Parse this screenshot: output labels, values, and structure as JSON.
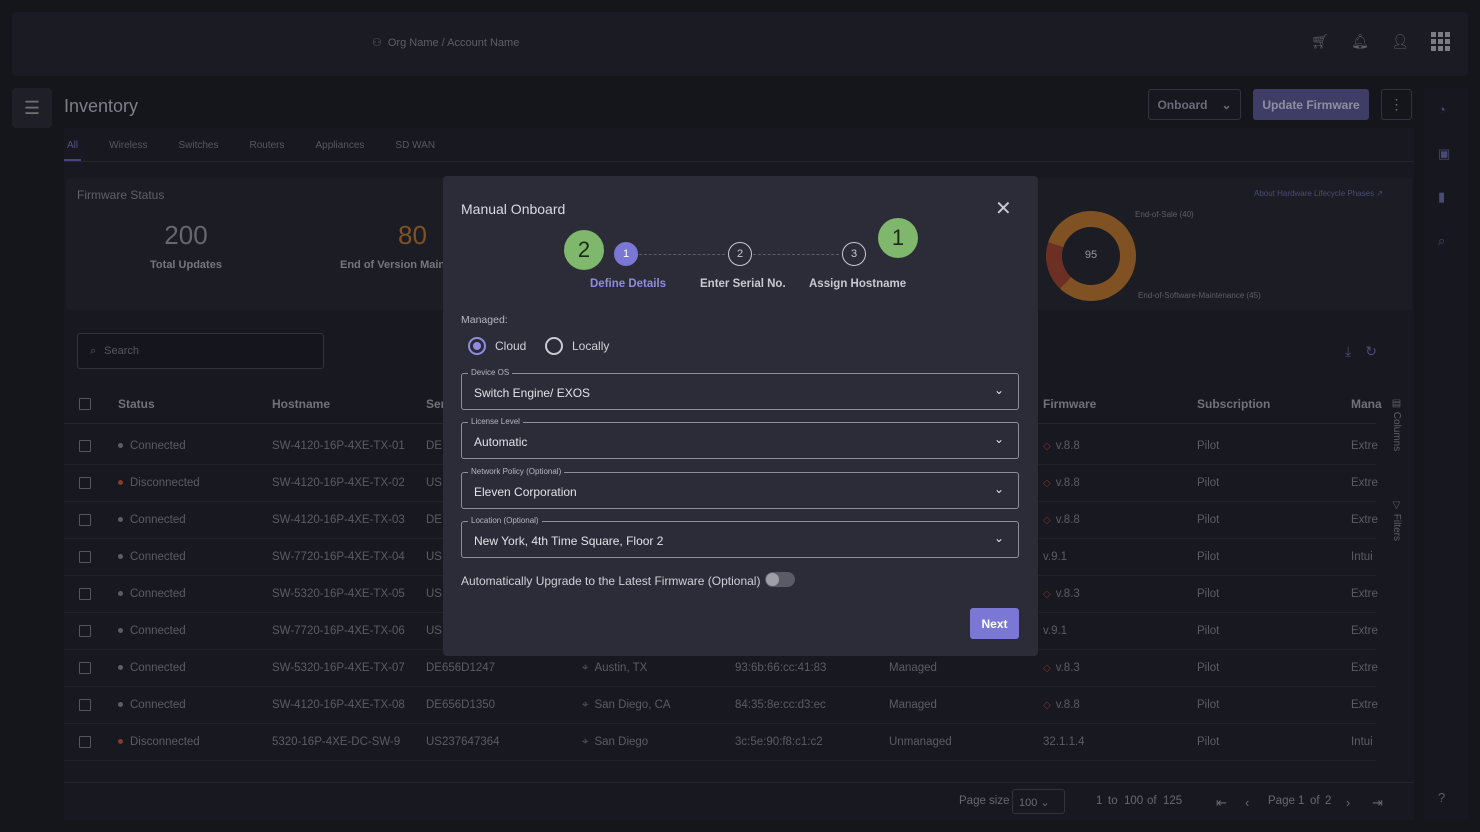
{
  "header": {
    "org_path": "Org Name / Account Name"
  },
  "page": {
    "title": "Inventory",
    "onboard_label": "Onboard",
    "update_firmware_label": "Update Firmware"
  },
  "tabs": [
    "All",
    "Wireless",
    "Switches",
    "Routers",
    "Appliances",
    "SD WAN"
  ],
  "firmware_status": {
    "title": "Firmware Status",
    "total_value": "200",
    "total_label": "Total Updates",
    "eovm_value": "80",
    "eovm_label": "End of Version Main",
    "donut_value": "95",
    "end_of_sale": "End-of-Sale (40)",
    "end_of_sw_maint": "End-of-Software-Maintenance (45)",
    "about_link": "About Hardware Lifecycle Phases"
  },
  "search": {
    "placeholder": "Search"
  },
  "table": {
    "headers": {
      "status": "Status",
      "hostname": "Hostname",
      "serial": "Ser",
      "firmware": "Firmware",
      "subscription": "Subscription",
      "managed_by": "Mana"
    },
    "rows": [
      {
        "status": "Connected",
        "hostname": "SW-4120-16P-4XE-TX-01",
        "serial": "DE",
        "location": "",
        "mac": "",
        "managed": "",
        "firmware": "v.8.8",
        "fw_warn": true,
        "subscription": "Pilot",
        "mgr": "Extre"
      },
      {
        "status": "Disconnected",
        "hostname": "SW-4120-16P-4XE-TX-02",
        "serial": "US",
        "location": "",
        "mac": "",
        "managed": "",
        "firmware": "v.8.8",
        "fw_warn": true,
        "subscription": "Pilot",
        "mgr": "Extre"
      },
      {
        "status": "Connected",
        "hostname": "SW-4120-16P-4XE-TX-03",
        "serial": "DE",
        "location": "",
        "mac": "",
        "managed": "",
        "firmware": "v.8.8",
        "fw_warn": true,
        "subscription": "Pilot",
        "mgr": "Extre"
      },
      {
        "status": "Connected",
        "hostname": "SW-7720-16P-4XE-TX-04",
        "serial": "US",
        "location": "",
        "mac": "",
        "managed": "",
        "firmware": "v.9.1",
        "fw_warn": false,
        "subscription": "Pilot",
        "mgr": "Intui"
      },
      {
        "status": "Connected",
        "hostname": "SW-5320-16P-4XE-TX-05",
        "serial": "US",
        "location": "",
        "mac": "",
        "managed": "",
        "firmware": "v.8.3",
        "fw_warn": true,
        "subscription": "Pilot",
        "mgr": "Extre"
      },
      {
        "status": "Connected",
        "hostname": "SW-7720-16P-4XE-TX-06",
        "serial": "US",
        "location": "",
        "mac": "",
        "managed": "",
        "firmware": "v.9.1",
        "fw_warn": false,
        "subscription": "Pilot",
        "mgr": "Extre"
      },
      {
        "status": "Connected",
        "hostname": "SW-5320-16P-4XE-TX-07",
        "serial": "DE656D1247",
        "location": "Austin, TX",
        "mac": "93:6b:66:cc:41:83",
        "managed": "Managed",
        "firmware": "v.8.3",
        "fw_warn": true,
        "subscription": "Pilot",
        "mgr": "Extre"
      },
      {
        "status": "Connected",
        "hostname": "SW-4120-16P-4XE-TX-08",
        "serial": "DE656D1350",
        "location": "San Diego, CA",
        "mac": "84:35:8e:cc:d3:ec",
        "managed": "Managed",
        "firmware": "v.8.8",
        "fw_warn": true,
        "subscription": "Pilot",
        "mgr": "Extre"
      },
      {
        "status": "Disconnected",
        "hostname": "5320-16P-4XE-DC-SW-9",
        "serial": "US237647364",
        "location": "San Diego",
        "mac": "3c:5e:90:f8:c1:c2",
        "managed": "Unmanaged",
        "firmware": "32.1.1.4",
        "fw_warn": false,
        "subscription": "Pilot",
        "mgr": "Intui"
      }
    ]
  },
  "side_tabs": {
    "columns": "Columns",
    "filters": "Filters"
  },
  "pager": {
    "page_size_label": "Page size",
    "page_size": "100",
    "range_from": "1",
    "to_word": "to",
    "range_to": "100",
    "of_word": "of",
    "total": "125",
    "page_word": "Page",
    "page": "1",
    "pages": "2"
  },
  "modal": {
    "title": "Manual Onboard",
    "steps": [
      {
        "num": "1",
        "label": "Define Details"
      },
      {
        "num": "2",
        "label": "Enter Serial No."
      },
      {
        "num": "3",
        "label": "Assign Hostname"
      }
    ],
    "annotation_badges": [
      "2",
      "1"
    ],
    "managed_label": "Managed:",
    "radio_cloud": "Cloud",
    "radio_locally": "Locally",
    "device_os_label": "Device OS",
    "device_os_value": "Switch Engine/ EXOS",
    "license_label": "License Level",
    "license_value": "Automatic",
    "policy_label": "Network Policy (Optional)",
    "policy_value": "Eleven Corporation",
    "location_label": "Location (Optional)",
    "location_value": "New York, 4th Time Square, Floor 2",
    "auto_upgrade_label": "Automatically Upgrade to the Latest Firmware (Optional)",
    "next_label": "Next"
  },
  "colors": {
    "accent": "#7b77d4",
    "badge_green": "#7fb76d",
    "status_connected": "#8a8b96",
    "status_disconnected": "#c8583e",
    "warn": "#b7493a"
  }
}
